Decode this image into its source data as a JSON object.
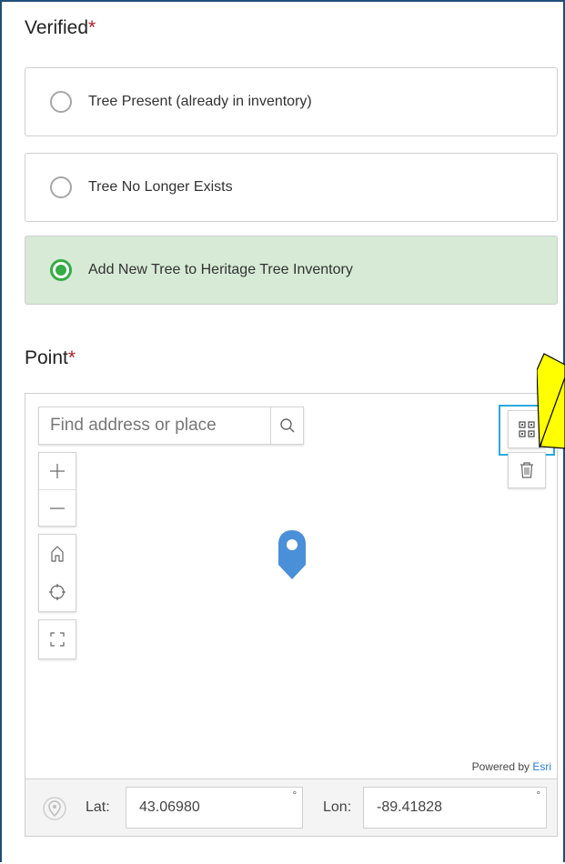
{
  "verified": {
    "title": "Verified",
    "required_mark": "*",
    "options": [
      {
        "label": "Tree Present (already in inventory)",
        "selected": false
      },
      {
        "label": "Tree No Longer Exists",
        "selected": false
      },
      {
        "label": "Add New Tree to Heritage Tree Inventory",
        "selected": true
      }
    ]
  },
  "point": {
    "title": "Point",
    "required_mark": "*"
  },
  "map": {
    "search_placeholder": "Find address or place",
    "powered_by_text": "Powered by ",
    "powered_by_brand": "Esri",
    "icons": [
      "search-icon",
      "zoom-in-icon",
      "zoom-out-icon",
      "home-icon",
      "locate-icon",
      "fullscreen-icon",
      "select-tool-icon",
      "trash-icon",
      "map-pin-icon",
      "location-icon"
    ]
  },
  "coordinates": {
    "lat_label": "Lat:",
    "lat_value": "43.06980",
    "lon_label": "Lon:",
    "lon_value": "-89.41828",
    "degree_symbol": "°"
  },
  "colors": {
    "accent_green": "#35ac46",
    "selected_bg": "#d6ead5",
    "highlight_blue": "#2aa9e0",
    "pin_blue": "#4a90d9",
    "required_red": "#a8232a",
    "arrow_yellow": "#ffff00"
  }
}
